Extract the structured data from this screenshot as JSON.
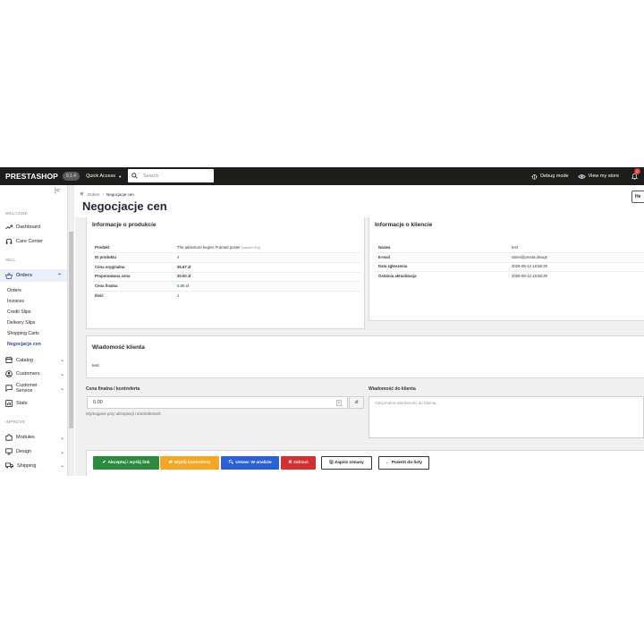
{
  "header": {
    "logo": "PRESTASHOP",
    "version": "9.1.4",
    "quick_access": "Quick Access",
    "search_placeholder": "Search",
    "debug_mode": "Debug mode",
    "view_store": "View my store",
    "notifications_count": "0"
  },
  "sidebar": {
    "sections": {
      "welcome": "WELCOME",
      "sell": "SELL",
      "improve": "IMPROVE"
    },
    "items": {
      "dashboard": "Dashboard",
      "care_center": "Care Center",
      "orders": "Orders",
      "catalog": "Catalog",
      "customers": "Customers",
      "customer_service_1": "Customer",
      "customer_service_2": "Service",
      "stats": "Stats",
      "modules": "Modules",
      "design": "Design",
      "shipping": "Shipping"
    },
    "orders_sub": [
      "Orders",
      "Invoices",
      "Credit Slips",
      "Delivery Slips",
      "Shopping Carts",
      "Negocjacje cen"
    ]
  },
  "breadcrumb": {
    "parent": "Orders",
    "current": "Negocjacje cen"
  },
  "page_title": "Negocjacje cen",
  "help_label": "He",
  "product_info": {
    "title": "Informacje o produkcie",
    "rows": [
      {
        "label": "Produkt",
        "value": "The adventure begins Framed poster",
        "ref": "(variant #16)"
      },
      {
        "label": "ID produktu",
        "value": "4"
      },
      {
        "label": "Cena oryginalna",
        "value": "35.67 zł"
      },
      {
        "label": "Proponowana cena",
        "value": "20.00 zł"
      },
      {
        "label": "Cena finalna",
        "value": "0.00 zł"
      },
      {
        "label": "Ilość",
        "value": "1"
      }
    ]
  },
  "client_info": {
    "title": "Informacje o kliencie",
    "rows": [
      {
        "label": "Nazwa",
        "value": "test"
      },
      {
        "label": "E-mail",
        "value": "sales@presta.design"
      },
      {
        "label": "Data zgłoszenia",
        "value": "2026-06-12 16:58:29"
      },
      {
        "label": "Ostatnia aktualizacja",
        "value": "2026-06-12 16:58:29"
      }
    ]
  },
  "client_message": {
    "title": "Wiadomość klienta",
    "text": "test"
  },
  "final_price": {
    "label": "Cena finalna / kontroferta",
    "value": "0.00",
    "currency": "zł",
    "help": "Wymagane przy akceptacji i kontrofertach."
  },
  "message_to_client": {
    "label": "Wiadomość do klienta",
    "placeholder": "Opcjonalna wiadomość do klienta..."
  },
  "buttons": {
    "accept": "Akceptuj i wyślij link",
    "counter": "Wyślij kontrofertę",
    "analyze": "Ustaw: W analizie",
    "reject": "Odrzuć",
    "save": "Zapisz zmiany",
    "back": "Powrót do listy"
  },
  "colors": {
    "accept": "#2b8a3e",
    "counter": "#f5a623",
    "analyze": "#2a61d6",
    "reject": "#d62f2f",
    "active_nav": "#2f4aa0"
  }
}
